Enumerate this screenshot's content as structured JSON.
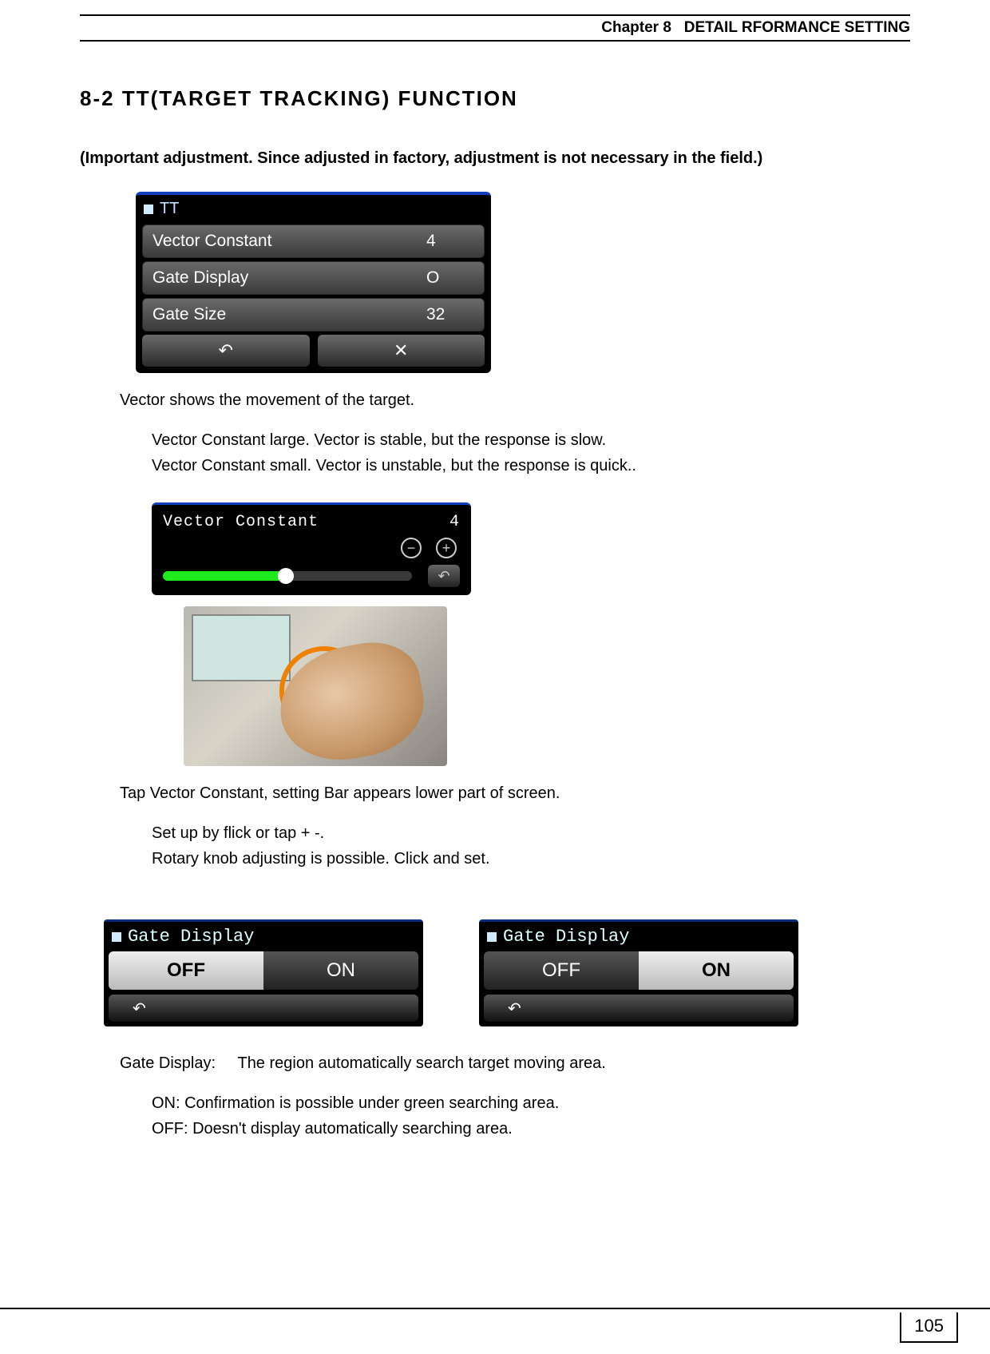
{
  "header": {
    "chapter": "Chapter 8",
    "title": "DETAIL RFORMANCE SETTING"
  },
  "section": {
    "number": "8-2",
    "title": "TT(TARGET TRACKING) FUNCTION"
  },
  "note": "(Important adjustment. Since adjusted in factory, adjustment is not necessary in the field.)",
  "tt_menu": {
    "title": "TT",
    "rows": [
      {
        "label": "Vector Constant",
        "value": "4"
      },
      {
        "label": "Gate Display",
        "value": "O"
      },
      {
        "label": "Gate Size",
        "value": "32"
      }
    ],
    "back_glyph": "↶",
    "close_glyph": "✕"
  },
  "body1": {
    "p1": "Vector shows the movement of the target.",
    "p2": "Vector Constant large. Vector is stable, but the response is slow.",
    "p3": "Vector Constant small. Vector is unstable, but the response is quick.."
  },
  "vc_widget": {
    "label": "Vector Constant",
    "value": "4",
    "minus": "−",
    "plus": "+",
    "back_glyph": "↶"
  },
  "body2": {
    "p1": "Tap Vector Constant, setting Bar appears lower part of   screen.",
    "p2": "Set up by flick or tap + -.",
    "p3": "Rotary knob adjusting is possible. Click and set."
  },
  "gate": {
    "title": "Gate Display",
    "off": "OFF",
    "on": "ON",
    "back_glyph": "↶"
  },
  "body3": {
    "p1": "Gate Display:     The region automatically search target moving area.",
    "p2": "ON: Confirmation is possible under green searching area.",
    "p3": "OFF: Doesn't display automatically searching area."
  },
  "page_number": "105"
}
